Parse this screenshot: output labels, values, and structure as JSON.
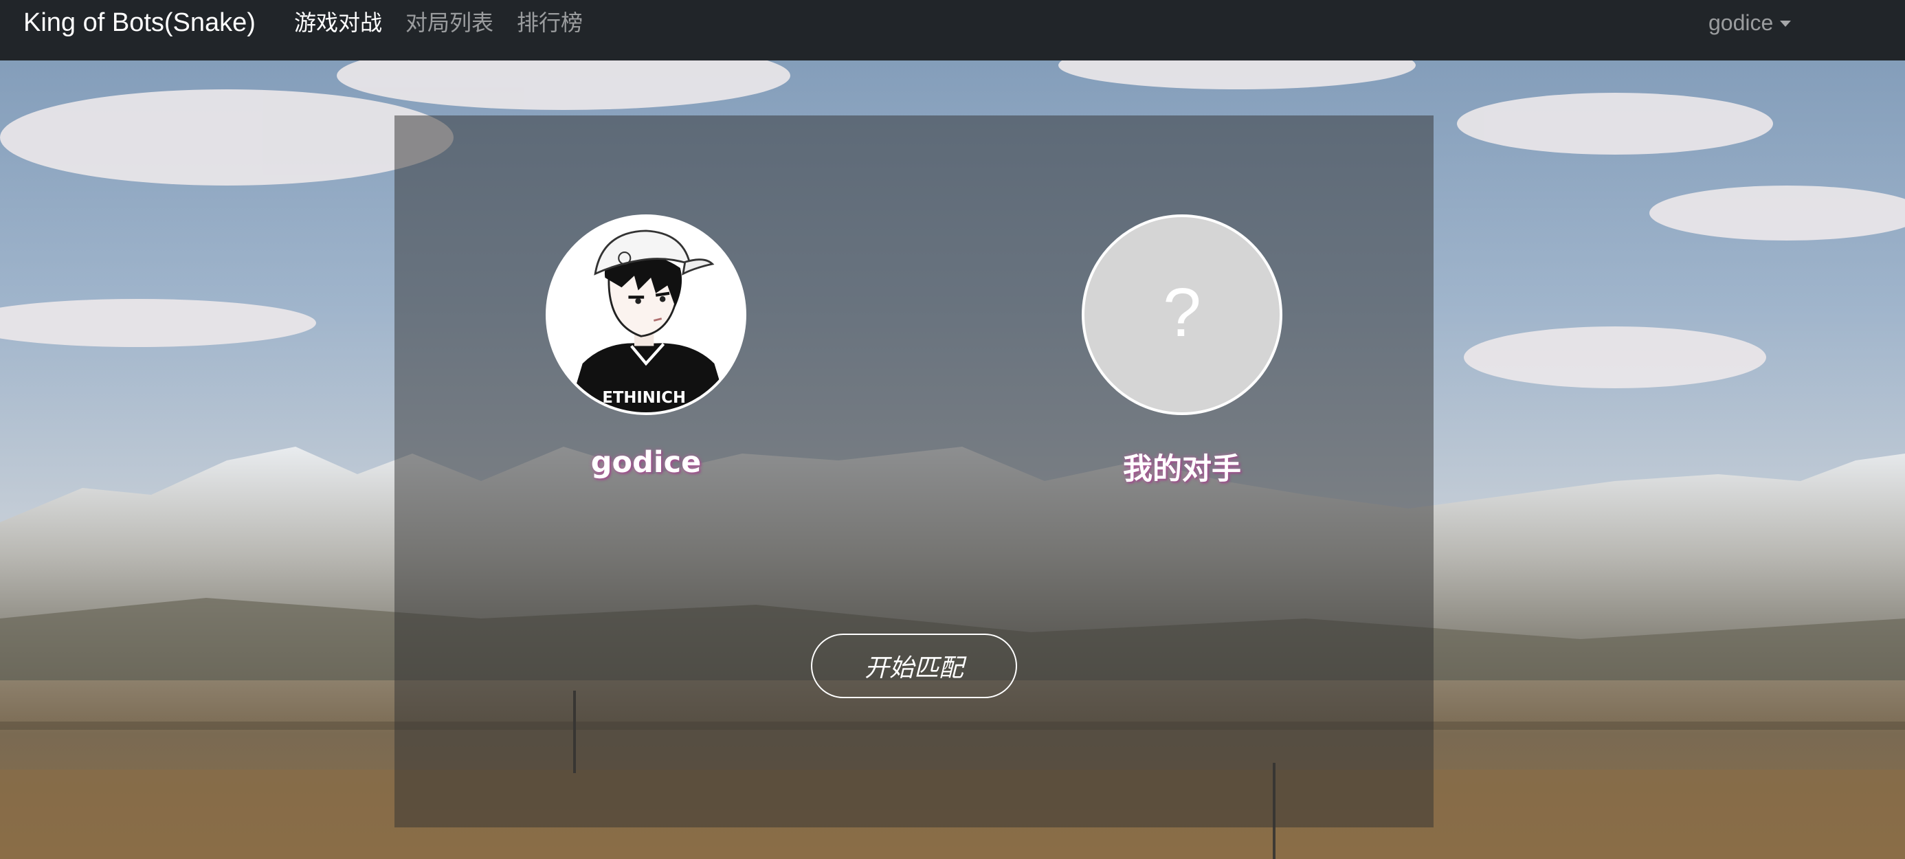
{
  "navbar": {
    "brand": "King of Bots(Snake)",
    "links": [
      {
        "label": "游戏对战",
        "active": true
      },
      {
        "label": "对局列表",
        "active": false
      },
      {
        "label": "排行榜",
        "active": false
      }
    ],
    "user": "godice"
  },
  "match": {
    "me": {
      "name": "godice"
    },
    "opponent": {
      "name": "我的对手",
      "placeholder": "?"
    },
    "start_button": "开始匹配"
  },
  "colors": {
    "navbar_bg": "#212529",
    "panel_bg": "rgba(50,50,50,0.5)",
    "name_glow": "#b464a0"
  }
}
